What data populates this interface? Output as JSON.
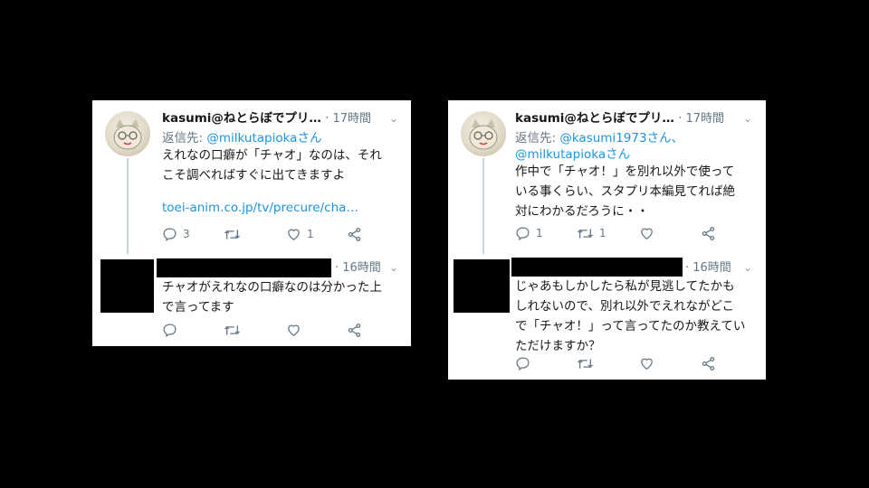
{
  "left": {
    "tweet1": {
      "name": "kasumi@ねとらぼでプリ…",
      "time": "· 17時間",
      "reply_prefix": "返信先: ",
      "reply_to": "@milkutapiokaさん",
      "text_line1": "えれなの口癖が「チャオ」なのは、それ",
      "text_line2": "こそ調べればすぐに出てきますよ",
      "link": "toei-anim.co.jp/tv/precure/cha…",
      "reply_count": "3",
      "retweet_count": "",
      "like_count": "1"
    },
    "tweet2": {
      "time": "· 16時間",
      "text_line1": "チャオがえれなの口癖なのは分かった上",
      "text_line2": "で言ってます"
    }
  },
  "right": {
    "tweet1": {
      "name": "kasumi@ねとらぼでプリ…",
      "time": "· 17時間",
      "reply_prefix": "返信先: ",
      "reply_to1": "@kasumi1973さん、",
      "reply_to2": "@milkutapiokaさん",
      "text_line1": "作中で「チャオ！」を別れ以外で使って",
      "text_line2": "いる事くらい、スタプリ本編見てれば絶",
      "text_line3": "対にわかるだろうに・・",
      "reply_count": "1",
      "retweet_count": "1",
      "like_count": ""
    },
    "tweet2": {
      "time": "· 16時間",
      "text_line1": "じゃあもしかしたら私が見逃してたかも",
      "text_line2": "しれないので、別れ以外でえれながどこ",
      "text_line3": "で「チャオ！」って言ってたのか教えてい",
      "text_line4": "ただけますか？"
    }
  },
  "icons": [
    "chevron-down-icon",
    "reply-icon",
    "retweet-icon",
    "like-icon",
    "share-icon"
  ]
}
